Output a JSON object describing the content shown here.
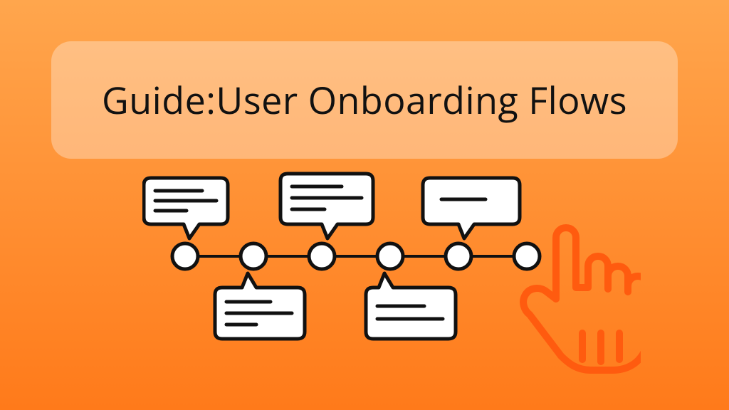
{
  "title": "Guide:User Onboarding Flows",
  "flow": {
    "step_count": 6,
    "bubbles": [
      {
        "position": "top",
        "step_index": 0,
        "lines": 3
      },
      {
        "position": "top",
        "step_index": 2,
        "lines": 3
      },
      {
        "position": "top",
        "step_index": 4,
        "lines": 1
      },
      {
        "position": "bottom",
        "step_index": 1,
        "lines": 3
      },
      {
        "position": "bottom",
        "step_index": 3,
        "lines": 2
      }
    ]
  },
  "icons": {
    "pointer": "pointing-hand-icon"
  },
  "colors": {
    "accent": "#FF5B0F",
    "stroke": "#111111",
    "fill": "#FFFFFF"
  }
}
